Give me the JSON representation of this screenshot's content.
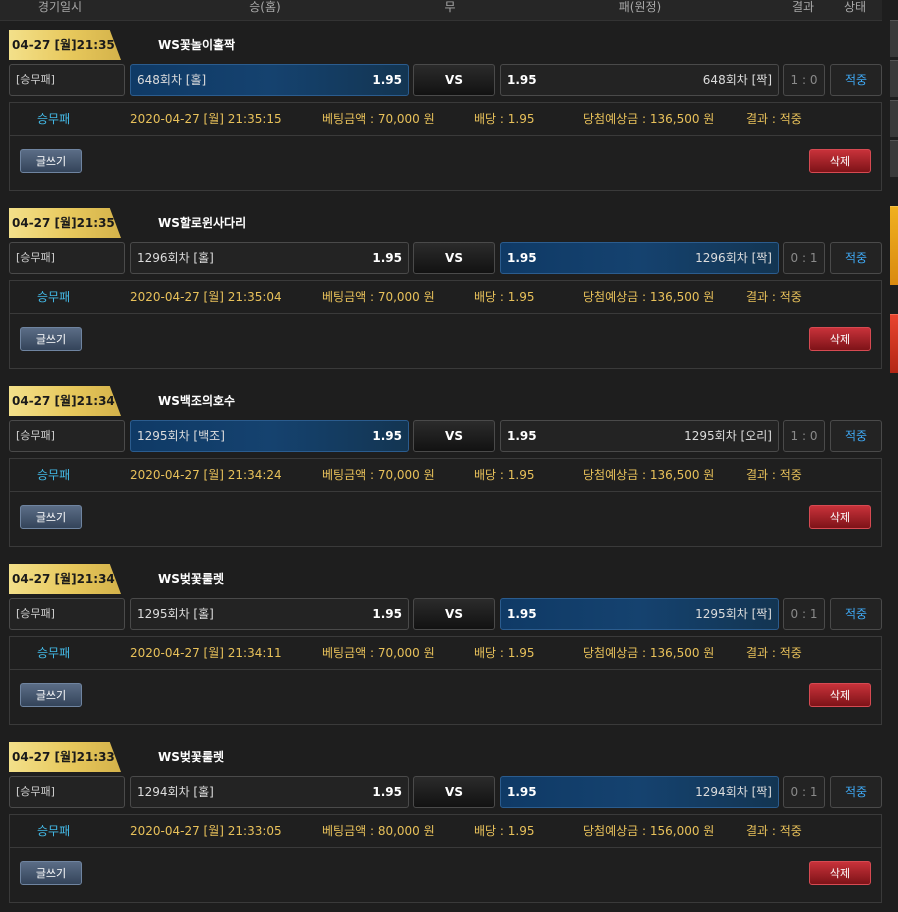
{
  "header": {
    "columns": [
      "경기일시",
      "승(홈)",
      "무",
      "패(원정)",
      "결과",
      "상태"
    ]
  },
  "labels": {
    "vs": "VS",
    "write_button": "글쓰기",
    "delete_button": "삭제"
  },
  "bets": [
    {
      "date_badge": "04-27 [월]21:35",
      "game": "WS꽃놀이홀짝",
      "type": "[승무패]",
      "home_team": "648회차 [홀]",
      "home_odds": "1.95",
      "away_odds": "1.95",
      "away_team": "648회차 [짝]",
      "score": "1 : 0",
      "status": "적중",
      "selected": "home",
      "detail": {
        "type": "승무패",
        "datetime": "2020-04-27 [월] 21:35:15",
        "amount": "베팅금액 : 70,000 원",
        "odds": "배당 : 1.95",
        "expected": "당첨예상금 : 136,500 원",
        "result": "결과 : 적중"
      }
    },
    {
      "date_badge": "04-27 [월]21:35",
      "game": "WS할로윈사다리",
      "type": "[승무패]",
      "home_team": "1296회차 [홀]",
      "home_odds": "1.95",
      "away_odds": "1.95",
      "away_team": "1296회차 [짝]",
      "score": "0 : 1",
      "status": "적중",
      "selected": "away",
      "detail": {
        "type": "승무패",
        "datetime": "2020-04-27 [월] 21:35:04",
        "amount": "베팅금액 : 70,000 원",
        "odds": "배당 : 1.95",
        "expected": "당첨예상금 : 136,500 원",
        "result": "결과 : 적중"
      }
    },
    {
      "date_badge": "04-27 [월]21:34",
      "game": "WS백조의호수",
      "type": "[승무패]",
      "home_team": "1295회차 [백조]",
      "home_odds": "1.95",
      "away_odds": "1.95",
      "away_team": "1295회차 [오리]",
      "score": "1 : 0",
      "status": "적중",
      "selected": "home",
      "detail": {
        "type": "승무패",
        "datetime": "2020-04-27 [월] 21:34:24",
        "amount": "베팅금액 : 70,000 원",
        "odds": "배당 : 1.95",
        "expected": "당첨예상금 : 136,500 원",
        "result": "결과 : 적중"
      }
    },
    {
      "date_badge": "04-27 [월]21:34",
      "game": "WS벚꽃룰렛",
      "type": "[승무패]",
      "home_team": "1295회차 [홀]",
      "home_odds": "1.95",
      "away_odds": "1.95",
      "away_team": "1295회차 [짝]",
      "score": "0 : 1",
      "status": "적중",
      "selected": "away",
      "detail": {
        "type": "승무패",
        "datetime": "2020-04-27 [월] 21:34:11",
        "amount": "베팅금액 : 70,000 원",
        "odds": "배당 : 1.95",
        "expected": "당첨예상금 : 136,500 원",
        "result": "결과 : 적중"
      }
    },
    {
      "date_badge": "04-27 [월]21:33",
      "game": "WS벚꽃룰렛",
      "type": "[승무패]",
      "home_team": "1294회차 [홀]",
      "home_odds": "1.95",
      "away_odds": "1.95",
      "away_team": "1294회차 [짝]",
      "score": "0 : 1",
      "status": "적중",
      "selected": "away",
      "detail": {
        "type": "승무패",
        "datetime": "2020-04-27 [월] 21:33:05",
        "amount": "베팅금액 : 80,000 원",
        "odds": "배당 : 1.95",
        "expected": "당첨예상금 : 156,000 원",
        "result": "결과 : 적중"
      }
    }
  ]
}
